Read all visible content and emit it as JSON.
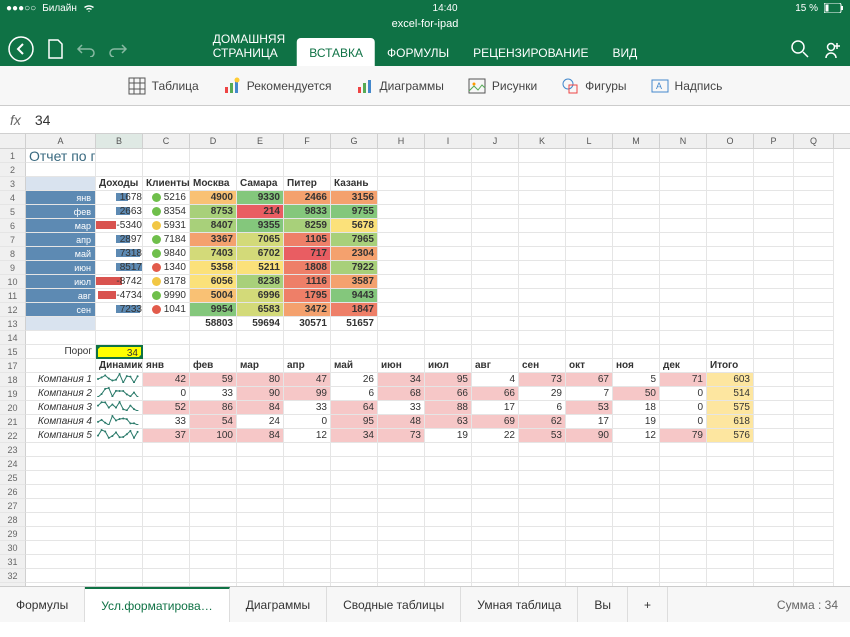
{
  "status": {
    "carrier": "Билайн",
    "time": "14:40",
    "battery": "15 %"
  },
  "app": {
    "title": "excel-for-ipad"
  },
  "tabs": {
    "home": "ДОМАШНЯЯ СТРАНИЦА",
    "insert": "ВСТАВКА",
    "formulas": "ФОРМУЛЫ",
    "review": "РЕЦЕНЗИРОВАНИЕ",
    "view": "ВИД"
  },
  "ribbon": {
    "table": "Таблица",
    "recommend": "Рекомендуется",
    "charts": "Диаграммы",
    "pictures": "Рисунки",
    "shapes": "Фигуры",
    "textbox": "Надпись"
  },
  "fx": {
    "label": "fx",
    "value": "34"
  },
  "sheet": {
    "title": "Отчет по продажам",
    "hdr2": {
      "B": "Доходы",
      "C": "Клиенты",
      "D": "Москва",
      "E": "Самара",
      "F": "Питер",
      "G": "Казань"
    },
    "months": [
      "янв",
      "фев",
      "мар",
      "апр",
      "май",
      "июн",
      "июл",
      "авг",
      "сен"
    ],
    "top_rows": [
      {
        "B": 1678,
        "C": 5216,
        "D": 4900,
        "E": 9330,
        "F": 2466,
        "G": 3156,
        "Bpos": true,
        "Bw": 12,
        "ind": "g"
      },
      {
        "B": 2663,
        "C": 8354,
        "D": 8753,
        "E": 214,
        "F": 9833,
        "G": 9755,
        "Bpos": true,
        "Bw": 14,
        "ind": "g"
      },
      {
        "B": -5340,
        "C": 5931,
        "D": 8407,
        "E": 9355,
        "F": 8259,
        "G": 5678,
        "Bpos": false,
        "Bw": 20,
        "ind": "y"
      },
      {
        "B": 2897,
        "C": 7184,
        "D": 3367,
        "E": 7065,
        "F": 1105,
        "G": 7965,
        "Bpos": true,
        "Bw": 14,
        "ind": "g"
      },
      {
        "B": 7318,
        "C": 9840,
        "D": 7403,
        "E": 6702,
        "F": 717,
        "G": 2304,
        "Bpos": true,
        "Bw": 24,
        "ind": "g"
      },
      {
        "B": 8517,
        "C": 1340,
        "D": 5358,
        "E": 5211,
        "F": 1808,
        "G": 7922,
        "Bpos": true,
        "Bw": 26,
        "ind": "r"
      },
      {
        "B": -8742,
        "C": 8178,
        "D": 6056,
        "E": 8238,
        "F": 1116,
        "G": 3587,
        "Bpos": false,
        "Bw": 26,
        "ind": "y"
      },
      {
        "B": -4734,
        "C": 9990,
        "D": 5004,
        "E": 6996,
        "F": 1795,
        "G": 9443,
        "Bpos": false,
        "Bw": 18,
        "ind": "g"
      },
      {
        "B": 7233,
        "C": 1041,
        "D": 9954,
        "E": 6583,
        "F": 3472,
        "G": 1847,
        "Bpos": true,
        "Bw": 24,
        "ind": "r"
      }
    ],
    "top_totals": {
      "D": 58803,
      "E": 59694,
      "F": 30571,
      "G": 51657
    },
    "threshold_label": "Порог",
    "threshold_val": 34,
    "dyn_label": "Динамика",
    "dyn_months": [
      "янв",
      "фев",
      "мар",
      "апр",
      "май",
      "июн",
      "июл",
      "авг",
      "сен",
      "окт",
      "ноя",
      "дек"
    ],
    "dyn_total": "Итого",
    "companies": [
      {
        "name": "Компания 1",
        "v": [
          42,
          59,
          80,
          47,
          26,
          34,
          95,
          4,
          73,
          67,
          5,
          71
        ],
        "t": 603
      },
      {
        "name": "Компания 2",
        "v": [
          0,
          33,
          90,
          99,
          6,
          68,
          66,
          66,
          29,
          7,
          50,
          0
        ],
        "t": 514
      },
      {
        "name": "Компания 3",
        "v": [
          52,
          86,
          84,
          33,
          64,
          33,
          88,
          17,
          6,
          53,
          18,
          0
        ],
        "t": 575
      },
      {
        "name": "Компания 4",
        "v": [
          33,
          54,
          24,
          0,
          95,
          48,
          63,
          69,
          62,
          17,
          19,
          0
        ],
        "t": 618
      },
      {
        "name": "Компания 5",
        "v": [
          37,
          100,
          84,
          12,
          34,
          73,
          19,
          22,
          53,
          90,
          12,
          79
        ],
        "t": 576
      }
    ]
  },
  "bottom": {
    "tabs": [
      "Формулы",
      "Усл.форматирова…",
      "Диаграммы",
      "Сводные таблицы",
      "Умная таблица",
      "Вы"
    ],
    "sum_label": "Сумма :",
    "sum_val": "34"
  },
  "colors": {
    "heat": [
      "#84c77c",
      "#a8d07a",
      "#d3da79",
      "#fbe17a",
      "#f9c174",
      "#f4a16e",
      "#ee7f68",
      "#e95d62"
    ]
  },
  "chart_data": [
    {
      "type": "bar",
      "title": "Доходы",
      "categories": [
        "янв",
        "фев",
        "мар",
        "апр",
        "май",
        "июн",
        "июл",
        "авг",
        "сен"
      ],
      "values": [
        1678,
        2663,
        -5340,
        2897,
        7318,
        8517,
        -8742,
        -4734,
        7233
      ]
    },
    {
      "type": "table",
      "title": "Динамика",
      "series": [
        {
          "name": "Компания 1",
          "values": [
            42,
            59,
            80,
            47,
            26,
            34,
            95,
            4,
            73,
            67,
            5,
            71
          ]
        },
        {
          "name": "Компания 2",
          "values": [
            0,
            33,
            90,
            99,
            6,
            68,
            66,
            66,
            29,
            7,
            50,
            0
          ]
        },
        {
          "name": "Компания 3",
          "values": [
            52,
            86,
            84,
            33,
            64,
            33,
            88,
            17,
            6,
            53,
            18,
            0
          ]
        },
        {
          "name": "Компания 4",
          "values": [
            33,
            54,
            24,
            0,
            95,
            48,
            63,
            69,
            62,
            17,
            19,
            0
          ]
        },
        {
          "name": "Компания 5",
          "values": [
            37,
            100,
            84,
            12,
            34,
            73,
            19,
            22,
            53,
            90,
            12,
            79
          ]
        }
      ],
      "categories": [
        "янв",
        "фев",
        "мар",
        "апр",
        "май",
        "июн",
        "июл",
        "авг",
        "сен",
        "окт",
        "ноя",
        "дек"
      ]
    }
  ]
}
